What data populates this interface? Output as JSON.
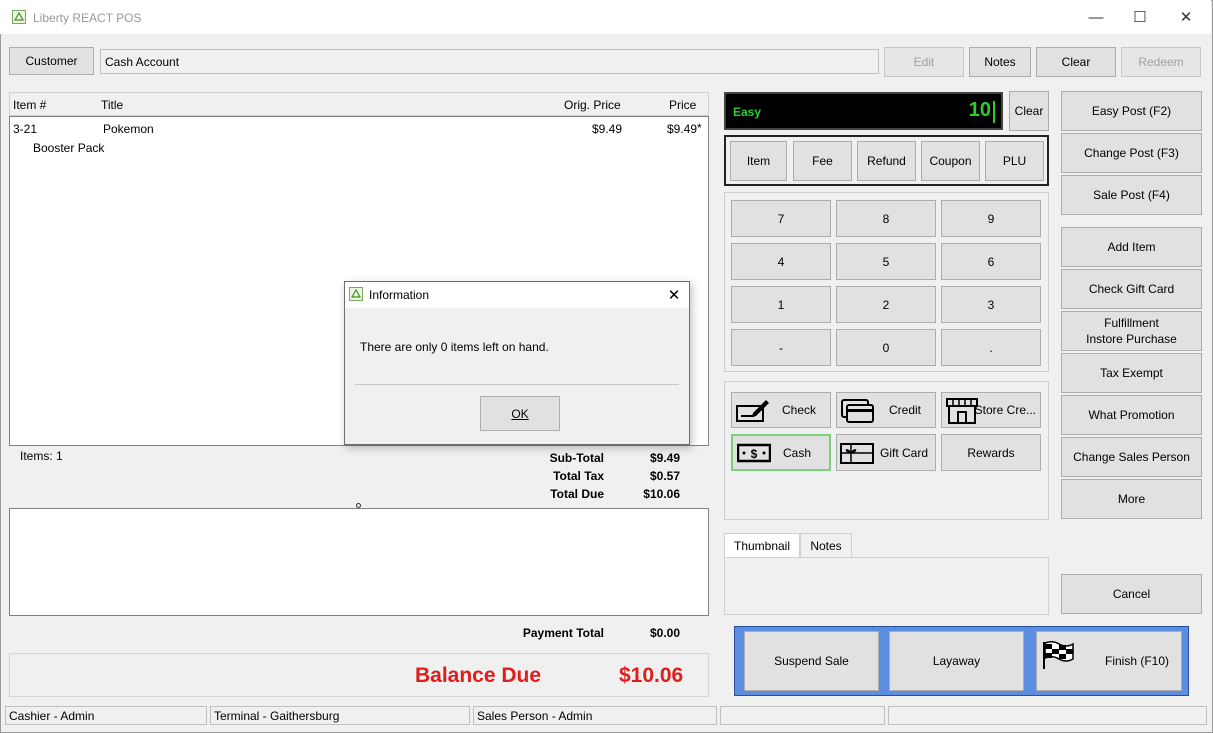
{
  "window": {
    "title": "Liberty REACT POS",
    "controls": {
      "minimize": "—",
      "maximize": "☐",
      "close": "✕"
    }
  },
  "toolbar": {
    "customer_label": "Customer",
    "customer_value": "Cash Account",
    "edit_label": "Edit",
    "notes_label": "Notes",
    "clear_label": "Clear",
    "redeem_label": "Redeem"
  },
  "grid": {
    "columns": [
      "Item #",
      "Title",
      "Orig. Price",
      "Price"
    ],
    "rows": [
      {
        "item_no": "3-21",
        "title": "Pokemon",
        "title_line2": "Booster Pack",
        "orig_price": "$9.49",
        "price": "$9.49",
        "flag": "*"
      }
    ]
  },
  "summary": {
    "items_count": "Items: 1",
    "subtotal_label": "Sub-Total",
    "subtotal": "$9.49",
    "tax_label": "Total Tax",
    "tax": "$0.57",
    "due_label": "Total Due",
    "due": "$10.06",
    "payment_label": "Payment Total",
    "payment": "$0.00",
    "balance_label": "Balance Due",
    "balance": "$10.06",
    "balance_color": "#e21b1b"
  },
  "display": {
    "mode": "Easy",
    "value": "10",
    "clear_label": "Clear",
    "color": "#2ecc2e"
  },
  "modes": [
    "Item",
    "Fee",
    "Refund",
    "Coupon",
    "PLU"
  ],
  "keypad": [
    "7",
    "8",
    "9",
    "4",
    "5",
    "6",
    "1",
    "2",
    "3",
    "-",
    "0",
    "."
  ],
  "tenders": {
    "check": "Check",
    "credit": "Credit",
    "store_credit": "Store Cre...",
    "cash": "Cash",
    "gift_card": "Gift Card",
    "rewards": "Rewards"
  },
  "tabs": [
    "Thumbnail",
    "Notes"
  ],
  "right_actions": {
    "easy_post": "Easy Post (F2)",
    "change_post": "Change Post (F3)",
    "sale_post": "Sale Post (F4)",
    "add_item": "Add Item",
    "check_gift_card": "Check Gift Card",
    "fulfillment_line1": "Fulfillment",
    "fulfillment_line2": "Instore Purchase",
    "tax_exempt": "Tax Exempt",
    "what_promotion": "What Promotion",
    "change_sales_person": "Change Sales Person",
    "more": "More",
    "cancel": "Cancel"
  },
  "finish": {
    "suspend": "Suspend Sale",
    "layaway": "Layaway",
    "finish": "Finish (F10)",
    "accent": "#5b8de0"
  },
  "statusbar": {
    "cashier": "Cashier - Admin",
    "terminal": "Terminal - Gaithersburg",
    "sales_person": "Sales Person - Admin"
  },
  "dialog": {
    "title": "Information",
    "message": "There are only 0 items left on hand.",
    "ok_label": "OK"
  }
}
